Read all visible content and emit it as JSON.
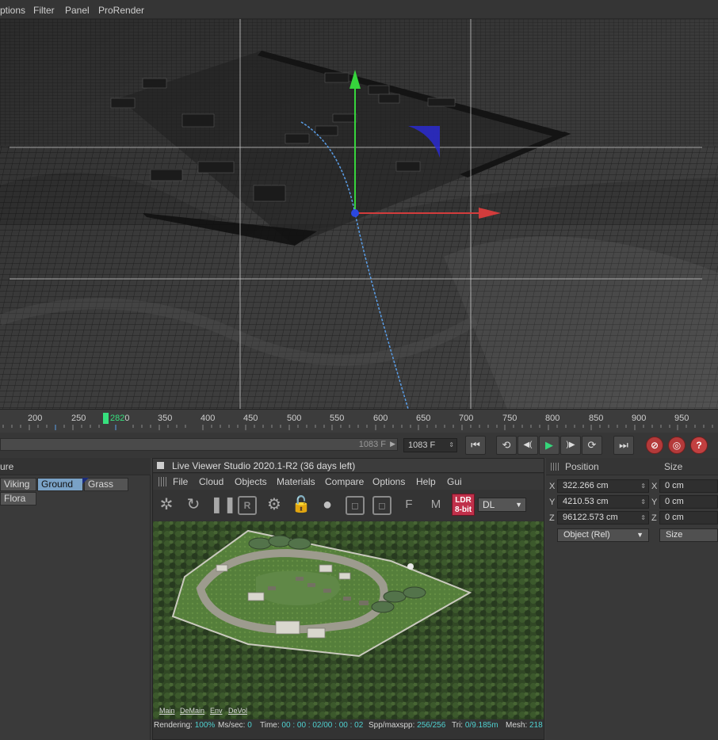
{
  "menubar": {
    "items": [
      "ptions",
      "Filter",
      "Panel",
      "ProRender"
    ]
  },
  "timeline": {
    "ticks": [
      "200",
      "250",
      "350",
      "400",
      "450",
      "500",
      "550",
      "600",
      "650",
      "700",
      "750",
      "800",
      "850",
      "900",
      "950"
    ],
    "current_frame_marker": "282",
    "marker_suffix": "0"
  },
  "transport": {
    "scrub_label": "1083 F",
    "frame_field": "1083 F",
    "buttons": [
      "⏮",
      "⟲",
      "◀(",
      "▶",
      ")▶",
      "⟳",
      "⏭"
    ],
    "help": "?"
  },
  "left_panel": {
    "header": "ure",
    "tabs": [
      "Viking",
      "Ground",
      "Grass",
      "Flora"
    ],
    "active_tab": "Ground"
  },
  "live_viewer": {
    "title": "Live Viewer Studio 2020.1-R2 (36 days left)",
    "menu": [
      "File",
      "Cloud",
      "Objects",
      "Materials",
      "Compare",
      "Options",
      "Help",
      "Gui"
    ],
    "ldr_line1": "LDR",
    "ldr_line2": "8-bit",
    "mode": "DL",
    "tool_letters": {
      "r": "R",
      "f": "F",
      "m": "M"
    },
    "tabs": [
      "Main",
      "DeMain",
      "Env",
      "DeVol"
    ],
    "status": {
      "rendering_label": "Rendering:",
      "rendering_value": "100%",
      "ms_label": "Ms/sec:",
      "ms_value": "0",
      "time_label": "Time:",
      "time_value": "00 : 00 : 02/00 : 00 : 02",
      "spp_label": "Spp/maxspp:",
      "spp_value": "256/256",
      "tri_label": "Tri:",
      "tri_value": "0/9.185m",
      "mesh_label": "Mesh:",
      "mesh_value": "218"
    }
  },
  "attributes": {
    "position_header": "Position",
    "size_header": "Size",
    "pos": [
      {
        "axis": "X",
        "value": "322.266 cm"
      },
      {
        "axis": "Y",
        "value": "4210.53 cm"
      },
      {
        "axis": "Z",
        "value": "96122.573 cm"
      }
    ],
    "size": [
      {
        "axis": "X",
        "value": "0 cm"
      },
      {
        "axis": "Y",
        "value": "0 cm"
      },
      {
        "axis": "Z",
        "value": "0 cm"
      }
    ],
    "coord_mode": "Object (Rel)",
    "size_mode": "Size"
  },
  "colors": {
    "accent_green": "#36e07e",
    "active_tab": "#7aa2c6",
    "ldr_badge": "#c0304a",
    "status_value": "#4fd0d0"
  }
}
